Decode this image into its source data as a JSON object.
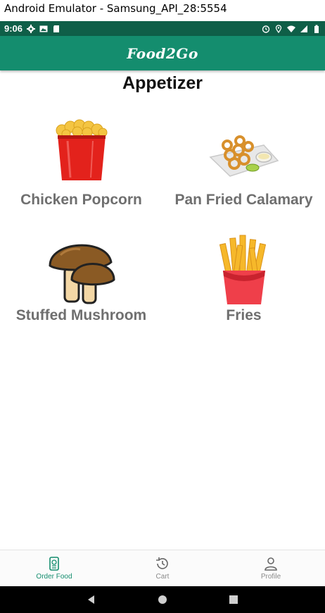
{
  "window": {
    "title": "Android Emulator - Samsung_API_28:5554"
  },
  "status_bar": {
    "time": "9:06",
    "left_icons": [
      "gear-icon",
      "image-icon",
      "sd-card-icon"
    ],
    "right_icons": [
      "alarm-icon",
      "location-icon",
      "wifi-icon",
      "signal-icon",
      "battery-icon"
    ]
  },
  "app_bar": {
    "title": "Food2Go",
    "color": "#148d6e"
  },
  "page": {
    "title": "Appetizer"
  },
  "items": [
    {
      "name": "Chicken Popcorn",
      "icon": "popcorn-bucket-icon"
    },
    {
      "name": "Pan Fried Calamary",
      "icon": "calamari-plate-icon"
    },
    {
      "name": "Stuffed Mushroom",
      "icon": "mushroom-icon"
    },
    {
      "name": "Fries",
      "icon": "fries-icon"
    }
  ],
  "bottom_nav": {
    "active_color": "#148d6e",
    "items": [
      {
        "label": "Order Food",
        "icon": "order-food-icon",
        "active": true
      },
      {
        "label": "Cart",
        "icon": "history-icon",
        "active": false
      },
      {
        "label": "Profile",
        "icon": "person-icon",
        "active": false
      }
    ]
  },
  "system_nav": {
    "buttons": [
      "back-icon",
      "home-icon",
      "recents-icon"
    ]
  }
}
